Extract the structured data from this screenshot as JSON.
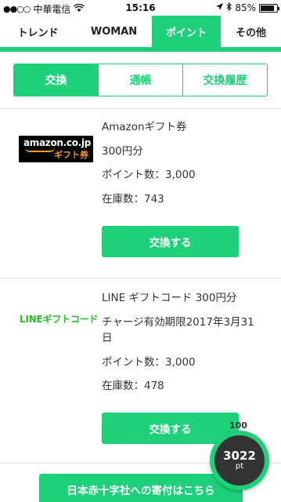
{
  "status_bar": {
    "signal": "●●○○",
    "carrier": "中華電信",
    "time": "15:16",
    "battery_text": "85%",
    "battery_level": 0.85
  },
  "top_tabs": [
    {
      "label": "トレンド",
      "active": false
    },
    {
      "label": "WOMAN",
      "active": false
    },
    {
      "label": "ポイント",
      "active": true
    },
    {
      "label": "その他",
      "active": false
    }
  ],
  "segments": [
    {
      "label": "交換",
      "active": true
    },
    {
      "label": "通帳",
      "active": false
    },
    {
      "label": "交換履歴",
      "active": false
    }
  ],
  "items": [
    {
      "logo_line1": "amazon.co.jp",
      "logo_line2": "ギフト券",
      "title": "Amazonギフト券",
      "subtitle": "300円分",
      "points": "ポイント数：3,000",
      "stock": "在庫数：743",
      "button": "交換する"
    },
    {
      "logo_text": "LINEギフトコード",
      "title": "LINE ギフトコード 300円分",
      "expiry_line1": "チャージ有効期限2017年3月31",
      "expiry_line2": "日",
      "points": "ポイント数：3,000",
      "stock": "在庫数：478",
      "button": "交換する"
    }
  ],
  "donation_button": "日本赤十字社への寄付はこちら",
  "point_badge": {
    "label": "100",
    "value": "3022",
    "unit": "pt"
  },
  "colors": {
    "accent": "#1ed07a",
    "badge_dark": "#333333"
  }
}
